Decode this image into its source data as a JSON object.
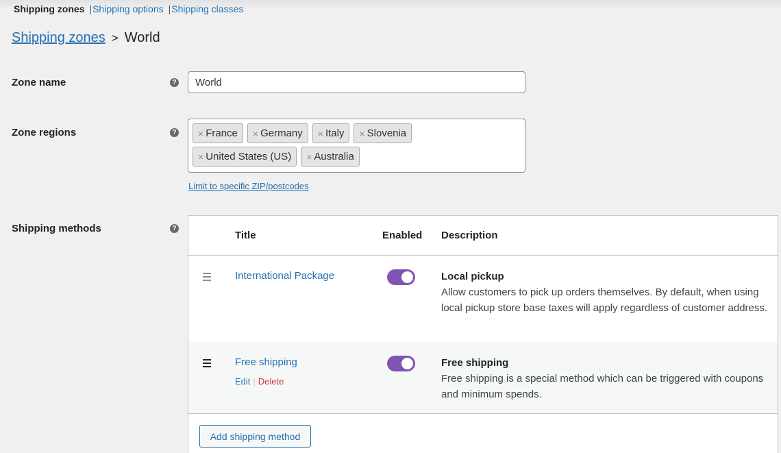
{
  "subnav": {
    "current": "Shipping zones",
    "sep1": "|",
    "options": "Shipping options",
    "sep2": "|",
    "classes": "Shipping classes"
  },
  "breadcrumb": {
    "parent": "Shipping zones",
    "separator": ">",
    "current": "World"
  },
  "zone_name": {
    "label": "Zone name",
    "help": "?",
    "value": "World"
  },
  "zone_regions": {
    "label": "Zone regions",
    "help": "?",
    "remove_glyph": "×",
    "chips": [
      "France",
      "Germany",
      "Italy",
      "Slovenia",
      "United States (US)",
      "Australia"
    ],
    "postcode_link": "Limit to specific ZIP/postcodes"
  },
  "shipping_methods": {
    "label": "Shipping methods",
    "help": "?",
    "columns": {
      "title": "Title",
      "enabled": "Enabled",
      "description": "Description"
    },
    "rows": [
      {
        "title": "International Package",
        "enabled": true,
        "desc_title": "Local pickup",
        "desc_text": "Allow customers to pick up orders themselves. By default, when using local pickup store base taxes will apply regardless of customer address."
      },
      {
        "title": "Free shipping",
        "enabled": true,
        "edit": "Edit",
        "action_sep": "|",
        "delete": "Delete",
        "desc_title": "Free shipping",
        "desc_text": "Free shipping is a special method which can be triggered with coupons and minimum spends."
      }
    ],
    "add_button": "Add shipping method"
  },
  "colors": {
    "accent": "#2271b1",
    "toggle_on": "#7f54b3",
    "delete": "#d63638",
    "background": "#f0f0f1"
  }
}
